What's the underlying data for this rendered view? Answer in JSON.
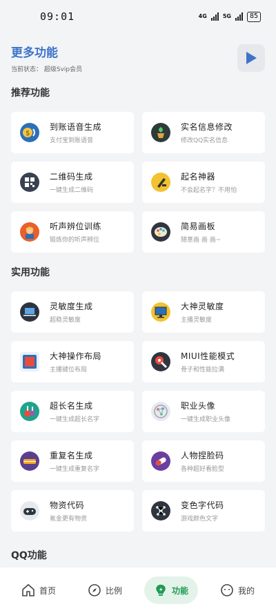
{
  "status_bar": {
    "time": "09:01",
    "net1": "4G",
    "net2": "5G",
    "battery": "85"
  },
  "header": {
    "title": "更多功能",
    "subtitle": "当前状态： 超级Svip会员"
  },
  "sections": {
    "recommended": {
      "title": "推荐功能",
      "items": [
        {
          "title": "到账语音生成",
          "desc": "支付宝到账语音",
          "icon": "coin-voice-icon"
        },
        {
          "title": "实名信息修改",
          "desc": "修改QQ实名信息",
          "icon": "plant-pot-icon"
        },
        {
          "title": "二维码生成",
          "desc": "一键生成二维码",
          "icon": "qr-code-icon"
        },
        {
          "title": "起名神器",
          "desc": "不会起名字？不用怕",
          "icon": "pen-icon"
        },
        {
          "title": "听声辨位训练",
          "desc": "锻炼你的听声辨位",
          "icon": "worker-icon"
        },
        {
          "title": "简易画板",
          "desc": "随意画 画 画~",
          "icon": "palette-icon"
        }
      ]
    },
    "practical": {
      "title": "实用功能",
      "items": [
        {
          "title": "灵敏度生成",
          "desc": "超稳灵敏度",
          "icon": "laptop-icon"
        },
        {
          "title": "大神灵敏度",
          "desc": "主播灵敏度",
          "icon": "monitor-icon"
        },
        {
          "title": "大神操作布局",
          "desc": "主播键位布局",
          "icon": "tablet-icon"
        },
        {
          "title": "MIUI性能模式",
          "desc": "骨子和性能拉满",
          "icon": "rocket-icon"
        },
        {
          "title": "超长名生成",
          "desc": "一键生成超长名字",
          "icon": "flask-icon"
        },
        {
          "title": "职业头像",
          "desc": "一键生成职业头像",
          "icon": "network-icon"
        },
        {
          "title": "重复名生成",
          "desc": "一键生成重复名字",
          "icon": "tag-icon"
        },
        {
          "title": "人物捏脸码",
          "desc": "各种超好看脸型",
          "icon": "pill-icon"
        },
        {
          "title": "物资代码",
          "desc": "氪金更有物资",
          "icon": "gamepad-icon"
        },
        {
          "title": "变色字代码",
          "desc": "游戏颜色文字",
          "icon": "molecule-icon"
        }
      ]
    },
    "qq": {
      "title": "QQ功能"
    }
  },
  "nav": {
    "home": "首页",
    "ratio": "比例",
    "functions": "功能",
    "mine": "我的"
  },
  "colors": {
    "accent_blue": "#3d73c9",
    "active_green": "#1f9b52"
  }
}
